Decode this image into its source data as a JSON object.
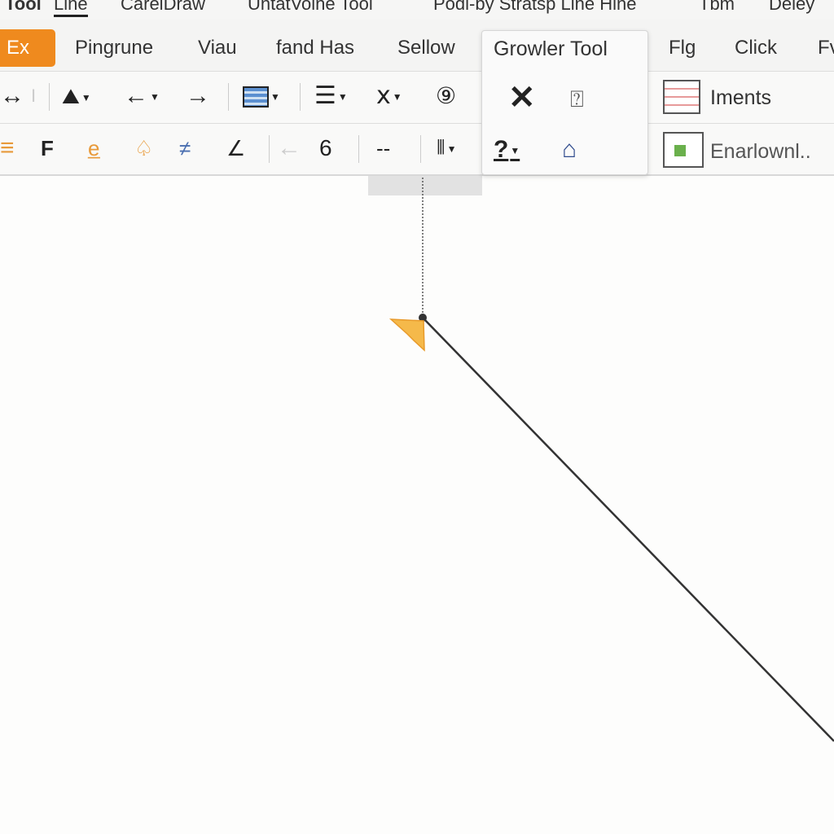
{
  "menu": [
    "Tool",
    "Line",
    "CarelDraw",
    "UntatVoine Tool",
    "Podl-by Stratsp Line Hine",
    "Tbm",
    "Deley"
  ],
  "tabs": [
    "Ex",
    "Pingrune",
    "Viau",
    "fand Has",
    "Sellow",
    "Flg",
    "Click",
    "Fv"
  ],
  "popup": {
    "title": "Growler Tool"
  },
  "toolbar2": {
    "number": "6",
    "dashes": "--"
  },
  "right": {
    "iments": "Iments",
    "enarlownl": "Enarlownl.."
  },
  "colors": {
    "accent": "#ef8a1e",
    "cursor": "#f5b94a"
  }
}
